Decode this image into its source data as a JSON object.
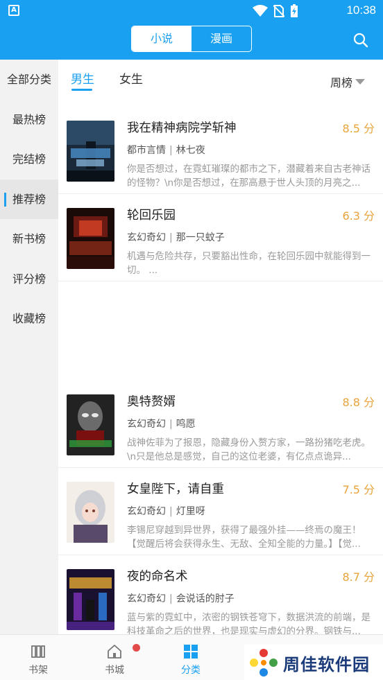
{
  "status_bar": {
    "time": "10:38"
  },
  "app_bar": {
    "tabs": [
      "小说",
      "漫画"
    ],
    "active_tab": 0
  },
  "sidebar": {
    "items": [
      "全部分类",
      "最热榜",
      "完结榜",
      "推荐榜",
      "新书榜",
      "评分榜",
      "收藏榜"
    ],
    "active_index": 3
  },
  "gender_tabs": {
    "male": "男生",
    "female": "女生",
    "ranking": "周榜"
  },
  "books": [
    {
      "title": "我在精神病院学斩神",
      "score": "8.5 分",
      "genre": "都市言情",
      "author": "林七夜",
      "desc": "你是否想过，在霓虹璀璨的都市之下，潜藏着来自古老神话的怪物？\\n你是否想过，在那高悬于世人头顶的月亮之..."
    },
    {
      "title": "轮回乐园",
      "score": "6.3 分",
      "genre": "玄幻奇幻",
      "author": "那一只蚊子",
      "desc": "机遇与危险共存，只要豁出性命，在轮回乐园中就能得到一切。 ..."
    },
    {
      "title": "奥特赘婿",
      "score": "8.8 分",
      "genre": "玄幻奇幻",
      "author": "鸣愿",
      "desc": "战神佐菲为了报恩，隐藏身份入赘方家，一路扮猪吃老虎。\\n只是他总是感觉，自己的这位老婆，有亿点点诡异..."
    },
    {
      "title": "女皇陛下，请自重",
      "score": "7.5 分",
      "genre": "玄幻奇幻",
      "author": "灯里呀",
      "desc": "李锡尼穿越到异世界，获得了最强外挂——终焉の魔王！【觉醒后将会获得永生、无敌、全知全能的力量。】【觉..."
    },
    {
      "title": "夜的命名术",
      "score": "8.7 分",
      "genre": "玄幻奇幻",
      "author": "会说话的肘子",
      "desc": "蓝与紫的霓虹中，浓密的钢铁苍穹下，数据洪流的前端，是科技革命之后的世界，也是现实与虚幻的分界。钢铁与..."
    }
  ],
  "bottom_nav": {
    "items": [
      "书架",
      "书城",
      "分类"
    ],
    "active_index": 2
  },
  "watermark": {
    "text": "周佳软件园"
  },
  "colors": {
    "accent": "#1aa0f0",
    "score": "#e8a33a"
  }
}
